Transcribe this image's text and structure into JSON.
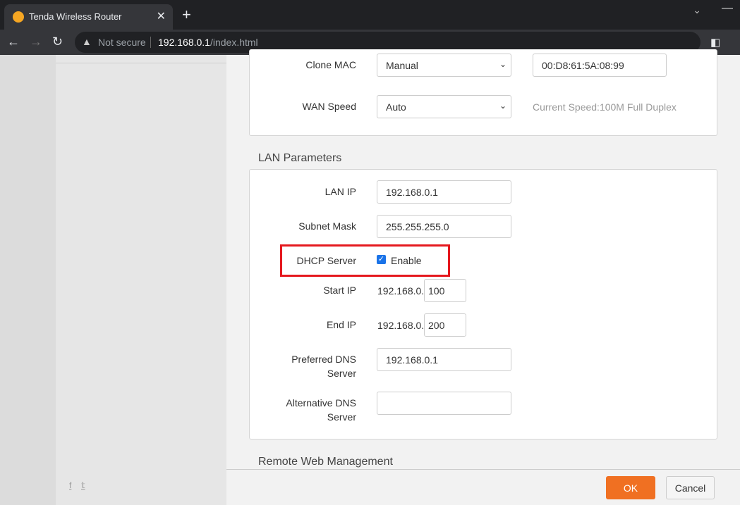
{
  "browser": {
    "tab_title": "Tenda Wireless Router",
    "security": "Not secure",
    "url_host": "192.168.0.1",
    "url_path": "/index.html"
  },
  "wan": {
    "clone_mac_label": "Clone MAC",
    "clone_mac_mode": "Manual",
    "clone_mac_value": "00:D8:61:5A:08:99",
    "wan_speed_label": "WAN Speed",
    "wan_speed_value": "Auto",
    "current_speed": "Current Speed:100M Full Duplex"
  },
  "lan": {
    "title": "LAN Parameters",
    "lan_ip_label": "LAN IP",
    "lan_ip": "192.168.0.1",
    "subnet_label": "Subnet Mask",
    "subnet": "255.255.255.0",
    "dhcp_label": "DHCP Server",
    "dhcp_enable_label": "Enable",
    "dhcp_enabled": true,
    "start_ip_label": "Start IP",
    "start_prefix": "192.168.0.",
    "start_suffix": "100",
    "end_ip_label": "End IP",
    "end_prefix": "192.168.0.",
    "end_suffix": "200",
    "pref_dns_label1": "Preferred DNS",
    "pref_dns_label2": "Server",
    "pref_dns": "192.168.0.1",
    "alt_dns_label1": "Alternative DNS",
    "alt_dns_label2": "Server",
    "alt_dns": ""
  },
  "remote": {
    "title": "Remote Web Management"
  },
  "sidebar": {
    "facebook": "f",
    "twitter": "𝕥"
  },
  "footer": {
    "ok": "OK",
    "cancel": "Cancel"
  }
}
